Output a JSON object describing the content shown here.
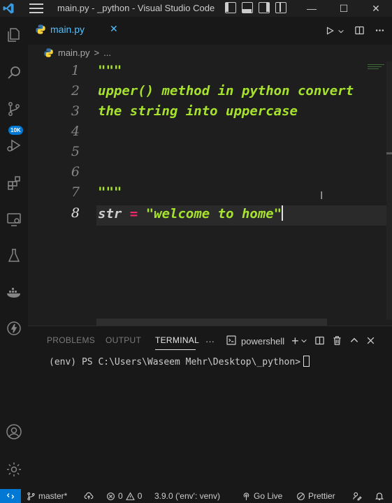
{
  "window": {
    "title": "main.py - _python - Visual Studio Code",
    "min": "—",
    "max": "☐",
    "close": "✕"
  },
  "activity_bar": {
    "items": [
      "explorer-icon",
      "search-icon",
      "source-control-icon",
      "run-debug-icon",
      "extensions-icon",
      "remote-explorer-icon",
      "testing-icon",
      "docker-icon",
      "lightning-icon",
      "account-icon",
      "settings-gear-icon"
    ],
    "scm_badge": "10K"
  },
  "tabs": [
    {
      "label": "main.py",
      "close": "✕"
    }
  ],
  "breadcrumb": {
    "file": "main.py",
    "separator": ">",
    "more": "..."
  },
  "editor": {
    "lines": [
      {
        "num": "1",
        "text": "\"\"\""
      },
      {
        "num": "2",
        "text": "upper() method in python convert"
      },
      {
        "num": "3",
        "text": "the string into uppercase"
      },
      {
        "num": "4",
        "text": ""
      },
      {
        "num": "5",
        "text": ""
      },
      {
        "num": "6",
        "text": ""
      },
      {
        "num": "7",
        "text": "\"\"\""
      },
      {
        "num": "8",
        "var": "str",
        "op": "=",
        "str": "\"welcome to home\""
      }
    ]
  },
  "panel": {
    "tabs": [
      "PROBLEMS",
      "OUTPUT",
      "TERMINAL"
    ],
    "active_tab": "TERMINAL",
    "more": "···",
    "shell": "powershell",
    "add": "+",
    "terminal_prompt": "(env) PS C:\\Users\\Waseem Mehr\\Desktop\\_python>"
  },
  "status_bar": {
    "remote": "><",
    "branch": "master*",
    "errors": "0",
    "warnings": "0",
    "python_version": "3.9.0 ('env': venv)",
    "go_live": "Go Live",
    "prettier": "Prettier"
  },
  "colors": {
    "accent": "#0078d4",
    "tab_active": "#4fc1ff",
    "string": "#a6e22e",
    "operator": "#f92672"
  }
}
